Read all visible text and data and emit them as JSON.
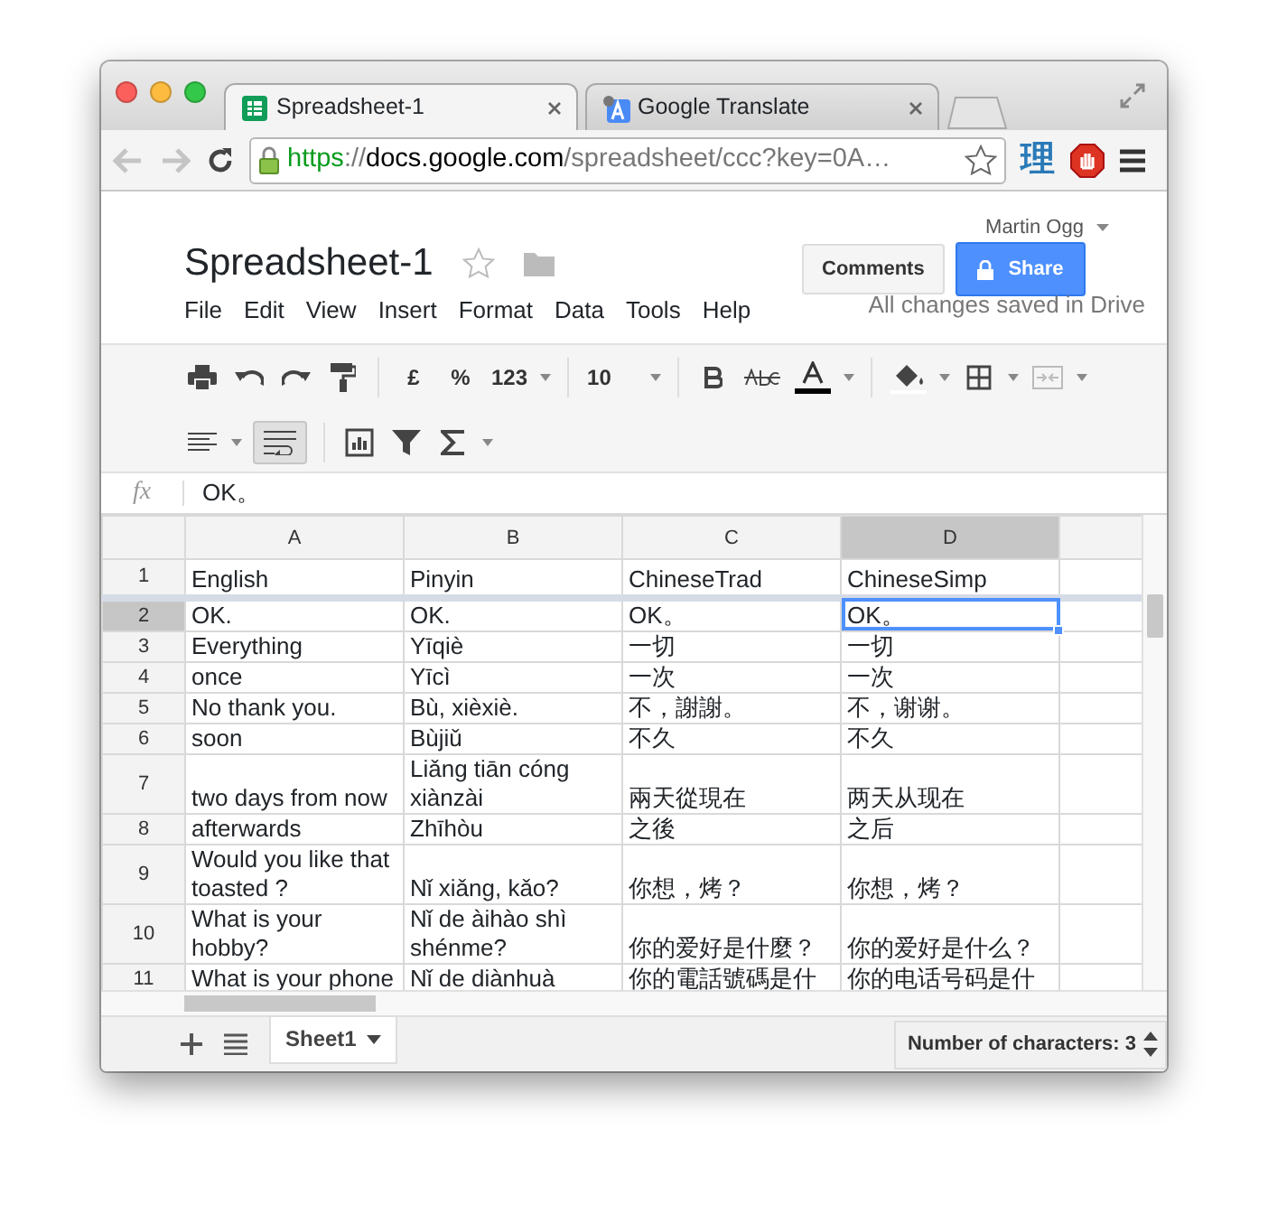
{
  "browser": {
    "tabs": [
      {
        "title": "Spreadsheet-1",
        "selected": true,
        "kind": "sheets"
      },
      {
        "title": "Google Translate",
        "selected": false,
        "kind": "translate"
      }
    ],
    "url": {
      "scheme": "https",
      "separator": "://",
      "host": "docs.google.com",
      "path": "/spreadsheet/ccc?key=0A…"
    },
    "extension_label": "理"
  },
  "document": {
    "title": "Spreadsheet-1",
    "user": "Martin Ogg",
    "comments_button": "Comments",
    "share_button": "Share",
    "menus": [
      "File",
      "Edit",
      "View",
      "Insert",
      "Format",
      "Data",
      "Tools",
      "Help"
    ],
    "save_status": "All changes saved in Drive"
  },
  "toolbar": {
    "currency": "£",
    "percent": "%",
    "number_format": "123",
    "font_size": "10",
    "wrap_text": {
      "selected": true
    }
  },
  "formula_bar": {
    "label": "fx",
    "value": "OK。"
  },
  "sheet": {
    "columns": [
      {
        "label": "A",
        "selected": false
      },
      {
        "label": "B",
        "selected": false
      },
      {
        "label": "C",
        "selected": false
      },
      {
        "label": "D",
        "selected": true
      }
    ],
    "rows": [
      {
        "number": "1",
        "selected": false,
        "frozen": true,
        "cells": [
          "English",
          "Pinyin",
          "ChineseTrad",
          "ChineseSimp"
        ]
      },
      {
        "number": "2",
        "selected": true,
        "frozen": false,
        "cells": [
          "OK.",
          "OK.",
          "OK。",
          "OK。"
        ]
      },
      {
        "number": "3",
        "selected": false,
        "frozen": false,
        "cells": [
          "Everything",
          "Yīqiè",
          "一切",
          "一切"
        ]
      },
      {
        "number": "4",
        "selected": false,
        "frozen": false,
        "cells": [
          "once",
          "Yīcì",
          "一次",
          "一次"
        ]
      },
      {
        "number": "5",
        "selected": false,
        "frozen": false,
        "cells": [
          "No thank you.",
          "Bù, xièxiè.",
          "不，謝謝。",
          "不，谢谢。"
        ]
      },
      {
        "number": "6",
        "selected": false,
        "frozen": false,
        "cells": [
          "soon",
          "Bùjiǔ",
          "不久",
          "不久"
        ]
      },
      {
        "number": "7",
        "selected": false,
        "frozen": false,
        "cells": [
          "two days from now",
          "Liǎng tiān cóng xiànzài",
          "兩天從現在",
          "两天从现在"
        ]
      },
      {
        "number": "8",
        "selected": false,
        "frozen": false,
        "cells": [
          "afterwards",
          "Zhīhòu",
          "之後",
          "之后"
        ]
      },
      {
        "number": "9",
        "selected": false,
        "frozen": false,
        "cells": [
          "Would you like that toasted ?",
          "Nǐ xiǎng, kǎo?",
          "你想，烤？",
          "你想，烤？"
        ]
      },
      {
        "number": "10",
        "selected": false,
        "frozen": false,
        "cells": [
          "What is your hobby?",
          "Nǐ de àihào shì shénme?",
          "你的爱好是什麼？",
          "你的爱好是什么？"
        ]
      },
      {
        "number": "11",
        "selected": false,
        "frozen": false,
        "cells": [
          "What is your phone",
          "Nǐ de diànhuà",
          "你的電話號碼是什",
          "你的电话号码是什"
        ]
      }
    ],
    "tabs": [
      {
        "label": "Sheet1",
        "selected": true
      }
    ],
    "status": "Number of characters: 3"
  }
}
